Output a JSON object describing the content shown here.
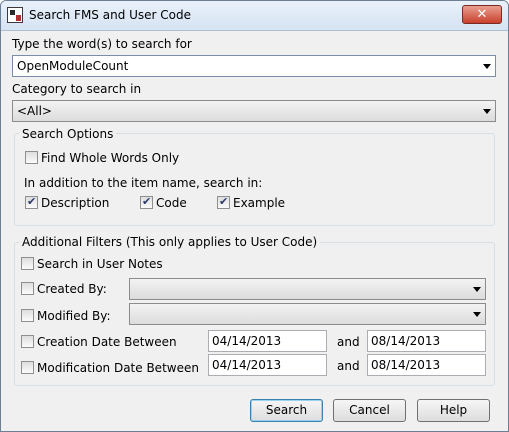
{
  "window": {
    "title": "Search FMS and User Code",
    "close_label": "✕"
  },
  "search": {
    "label": "Type the word(s) to search for",
    "value": "OpenModuleCount"
  },
  "category": {
    "label": "Category to search in",
    "value": "<All>"
  },
  "search_options": {
    "legend": "Search Options",
    "whole_words": {
      "label": "Find Whole Words Only",
      "checked": false
    },
    "also_search_label": "In addition to the item name, search in:",
    "description": {
      "label": "Description",
      "checked": true
    },
    "code": {
      "label": "Code",
      "checked": true
    },
    "example": {
      "label": "Example",
      "checked": true
    }
  },
  "filters": {
    "legend": "Additional Filters (This only applies to User Code)",
    "user_notes": {
      "label": "Search in User Notes",
      "checked": false
    },
    "created_by": {
      "label": "Created By:",
      "checked": false,
      "value": ""
    },
    "modified_by": {
      "label": "Modified By:",
      "checked": false,
      "value": ""
    },
    "creation_date": {
      "label": "Creation Date Between",
      "checked": false,
      "from": "04/14/2013",
      "and": "and",
      "to": "08/14/2013"
    },
    "modification_date": {
      "label": "Modification Date Between",
      "checked": false,
      "from": "04/14/2013",
      "and": "and",
      "to": "08/14/2013"
    }
  },
  "buttons": {
    "search": "Search",
    "cancel": "Cancel",
    "help": "Help"
  }
}
